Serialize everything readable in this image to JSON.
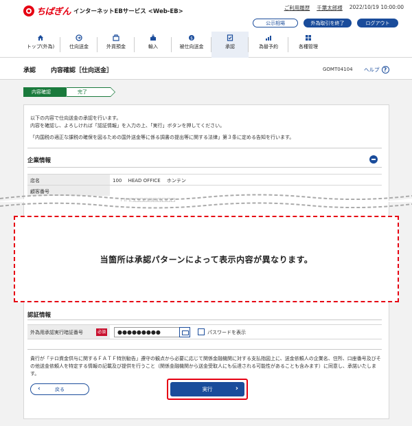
{
  "header": {
    "logo_text": "ちばぎん",
    "service_name": "インターネットEBサービス <Web-EB>",
    "links": {
      "usage_history": "ご利用履歴",
      "user_name": "千葉太郎様",
      "datetime": "2022/10/19 10:00:00"
    },
    "buttons": {
      "rates": "公示相場",
      "end_fx": "外為取引を終了",
      "logout": "ログアウト"
    }
  },
  "nav": {
    "items": [
      {
        "label": "トップ(外為)",
        "icon": "home-icon"
      },
      {
        "label": "仕向送金",
        "icon": "send-icon"
      },
      {
        "label": "外貨預金",
        "icon": "deposit-icon"
      },
      {
        "label": "輸入",
        "icon": "import-icon"
      },
      {
        "label": "被仕向送金",
        "icon": "receive-icon"
      },
      {
        "label": "承認",
        "icon": "approve-icon"
      },
      {
        "label": "為替予約",
        "icon": "chart-icon"
      },
      {
        "label": "各種管理",
        "icon": "grid-icon"
      }
    ],
    "active_index": 5
  },
  "title": {
    "primary": "承認",
    "secondary": "内容確認［仕向送金］",
    "screen_code": "GOMT04104",
    "help": "ヘルプ"
  },
  "steps": {
    "current": "内容確認",
    "next": "完了"
  },
  "intro": {
    "line1": "以下の内容で仕向送金の承認を行います。",
    "line2": "内容を確認し、よろしければ「認証情報」を入力の上、「実行」ボタンを押してください。",
    "note": "「内国税の適正な課税の確保を図るための国外送金等に係る調書の提出等に関する法律」第３条に定める告知を行います。"
  },
  "company": {
    "title": "企業情報",
    "rows": [
      {
        "key": "店名",
        "value": "100　 HEAD OFFICE　 ホンテン"
      },
      {
        "key": "顧客番号",
        "value": ""
      }
    ],
    "partial": "□□□□□□□□□□□□"
  },
  "annotation": "当箇所は承認パターンによって表示内容が異なります。",
  "auth": {
    "title": "認証情報",
    "label": "外為用承認実行暗証番号",
    "required": "必須",
    "password_mask": "●●●●●●●●●",
    "show_password": "パスワードを表示"
  },
  "disclaimer": "貴行が「テロ資金供与に関するＦＡＴＦ特別勧告」遵守の観点から必要に応じて関係金融機関に対する支払指図上に、送金依頼人の企業名、住所、口座番号及びその他送金依頼人を特定する情報の記載及び提供を行うこと（関係金融機関から送金受取人にも伝達される可能性があることも含みます）に同意し、承諾いたします。",
  "buttons": {
    "back": "戻る",
    "execute": "実行"
  },
  "colors": {
    "brand_red": "#e60012",
    "navy": "#1a4c9b",
    "step_green": "#1a7a3c"
  }
}
